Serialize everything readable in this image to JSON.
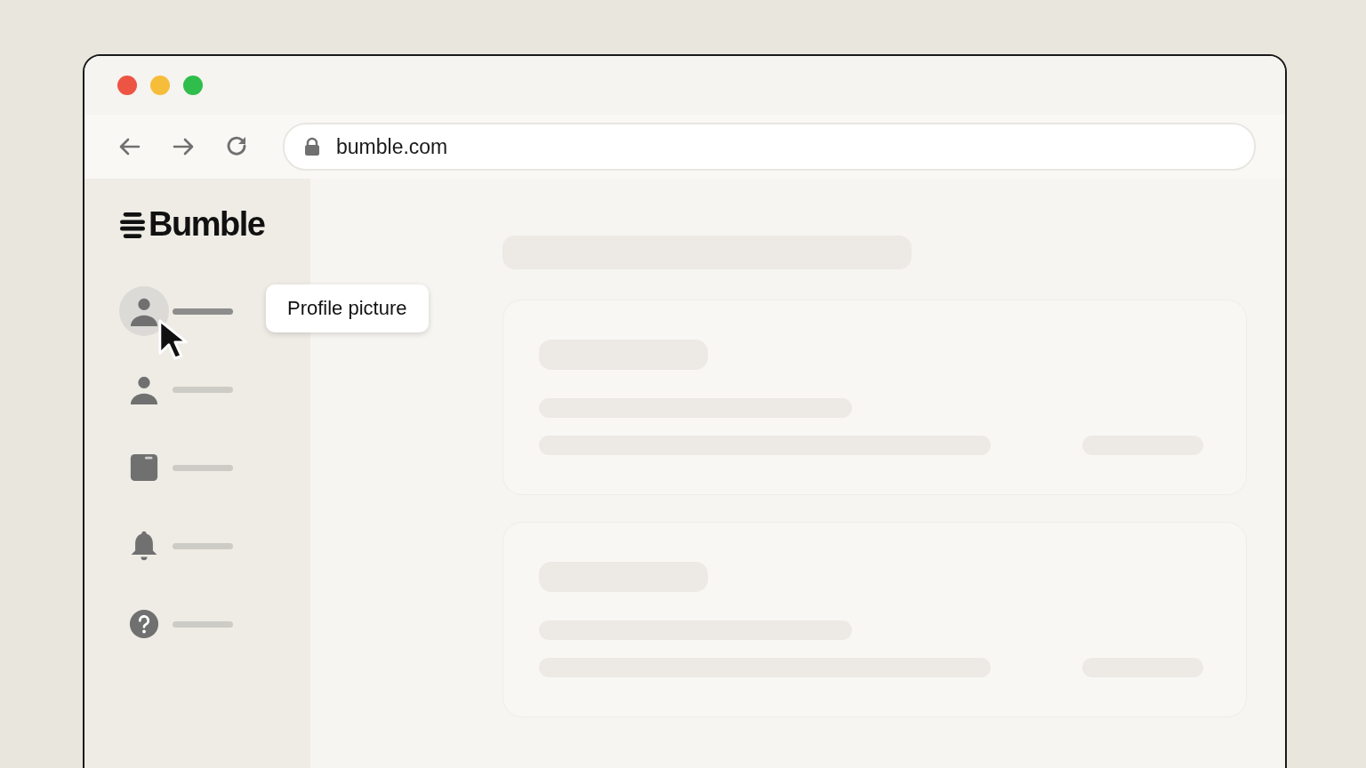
{
  "browser": {
    "url": "bumble.com"
  },
  "brand": {
    "name": "Bumble"
  },
  "sidebar": {
    "items": [
      {
        "kind": "avatar",
        "selected": true,
        "tooltip": "Profile picture"
      },
      {
        "kind": "person",
        "selected": false
      },
      {
        "kind": "folder",
        "selected": false
      },
      {
        "kind": "bell",
        "selected": false
      },
      {
        "kind": "help",
        "selected": false
      }
    ]
  }
}
